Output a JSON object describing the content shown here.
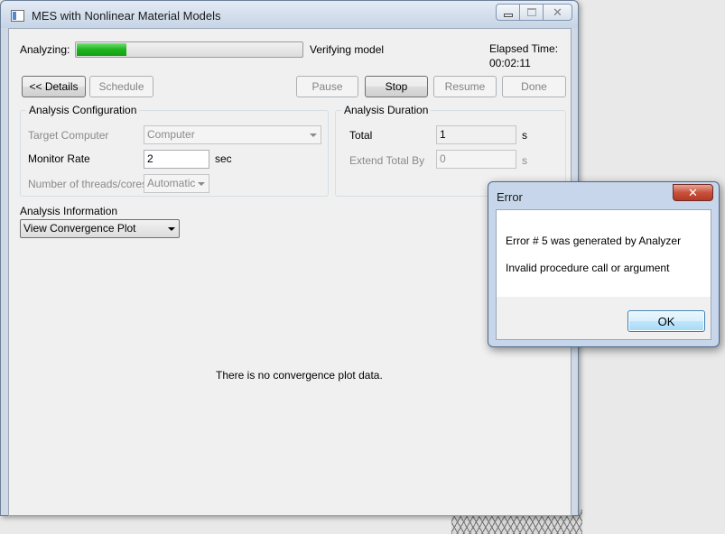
{
  "main_window": {
    "title": "MES with Nonlinear Material Models",
    "status": {
      "analyzing_label": "Analyzing:",
      "progress_fraction": 0.22,
      "progress_text": "Verifying model",
      "elapsed_label": "Elapsed Time:",
      "elapsed_value": "00:02:11"
    },
    "toolbar": {
      "details": "<< Details",
      "schedule": "Schedule",
      "pause": "Pause",
      "stop": "Stop",
      "resume": "Resume",
      "done": "Done"
    },
    "config": {
      "title": "Analysis Configuration",
      "target_label": "Target Computer",
      "target_value": "Computer",
      "monitor_label": "Monitor Rate",
      "monitor_value": "2",
      "monitor_unit": "sec",
      "threads_label": "Number of threads/cores",
      "threads_value": "Automatic"
    },
    "duration": {
      "title": "Analysis Duration",
      "total_label": "Total",
      "total_value": "1",
      "total_unit": "s",
      "extend_label": "Extend Total By",
      "extend_value": "0",
      "extend_unit": "s"
    },
    "info": {
      "title": "Analysis Information",
      "view_selected": "View Convergence Plot",
      "empty_message": "There is no convergence plot data."
    }
  },
  "error_dialog": {
    "title": "Error",
    "close_glyph": "✕",
    "line1": "Error #  5 was generated by Analyzer",
    "line2": "Invalid procedure call or argument",
    "ok": "OK"
  }
}
